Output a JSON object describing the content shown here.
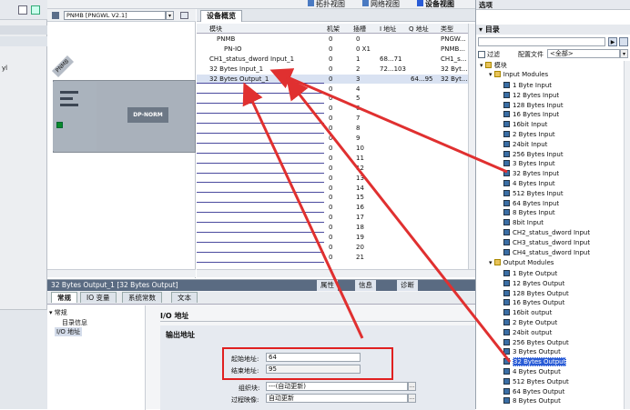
{
  "top_toolbar": {
    "topology_view": "拓扑视图",
    "network_view": "网络视图",
    "device_view": "设备视图"
  },
  "device_toolbar": {
    "device_select": "PNMB [PNGWL V2.1]"
  },
  "device_graphic": {
    "rack_label": "PNMB",
    "module_label": "DP-NORM"
  },
  "overview": {
    "title": "设备概览",
    "headers": [
      "模块",
      "机架",
      "插槽",
      "I 地址",
      "Q 地址",
      "类型"
    ],
    "rows": [
      {
        "module": "PNMB",
        "rack": "0",
        "slot": "0",
        "i": "",
        "q": "",
        "type": "PNGW..."
      },
      {
        "module": "PN-IO",
        "rack": "0",
        "slot": "0 X1",
        "i": "",
        "q": "",
        "type": "PNMB..."
      },
      {
        "module": "CH1_status_dword Input_1",
        "rack": "0",
        "slot": "1",
        "i": "68...71",
        "q": "",
        "type": "CH1_s..."
      },
      {
        "module": "32 Bytes Input_1",
        "rack": "0",
        "slot": "2",
        "i": "72...103",
        "q": "",
        "type": "32 Byt..."
      },
      {
        "module": "32 Bytes Output_1",
        "rack": "0",
        "slot": "3",
        "i": "",
        "q": "64...95",
        "type": "32 Byt..."
      },
      {
        "module": "",
        "rack": "0",
        "slot": "4",
        "i": "",
        "q": "",
        "type": ""
      },
      {
        "module": "",
        "rack": "0",
        "slot": "5",
        "i": "",
        "q": "",
        "type": ""
      },
      {
        "module": "",
        "rack": "0",
        "slot": "6",
        "i": "",
        "q": "",
        "type": ""
      },
      {
        "module": "",
        "rack": "0",
        "slot": "7",
        "i": "",
        "q": "",
        "type": ""
      },
      {
        "module": "",
        "rack": "0",
        "slot": "8",
        "i": "",
        "q": "",
        "type": ""
      },
      {
        "module": "",
        "rack": "0",
        "slot": "9",
        "i": "",
        "q": "",
        "type": ""
      },
      {
        "module": "",
        "rack": "0",
        "slot": "10",
        "i": "",
        "q": "",
        "type": ""
      },
      {
        "module": "",
        "rack": "0",
        "slot": "11",
        "i": "",
        "q": "",
        "type": ""
      },
      {
        "module": "",
        "rack": "0",
        "slot": "12",
        "i": "",
        "q": "",
        "type": ""
      },
      {
        "module": "",
        "rack": "0",
        "slot": "13",
        "i": "",
        "q": "",
        "type": ""
      },
      {
        "module": "",
        "rack": "0",
        "slot": "14",
        "i": "",
        "q": "",
        "type": ""
      },
      {
        "module": "",
        "rack": "0",
        "slot": "15",
        "i": "",
        "q": "",
        "type": ""
      },
      {
        "module": "",
        "rack": "0",
        "slot": "16",
        "i": "",
        "q": "",
        "type": ""
      },
      {
        "module": "",
        "rack": "0",
        "slot": "17",
        "i": "",
        "q": "",
        "type": ""
      },
      {
        "module": "",
        "rack": "0",
        "slot": "18",
        "i": "",
        "q": "",
        "type": ""
      },
      {
        "module": "",
        "rack": "0",
        "slot": "19",
        "i": "",
        "q": "",
        "type": ""
      },
      {
        "module": "",
        "rack": "0",
        "slot": "20",
        "i": "",
        "q": "",
        "type": ""
      },
      {
        "module": "",
        "rack": "0",
        "slot": "21",
        "i": "",
        "q": "",
        "type": ""
      }
    ]
  },
  "props": {
    "title": "32 Bytes Output_1 [32 Bytes Output]",
    "panel_tabs": [
      "属性",
      "信息",
      "诊断"
    ],
    "tabs": [
      "常规",
      "IO 变量",
      "系统常数",
      "文本"
    ],
    "nav": [
      "常规",
      "目录信息",
      "I/O 地址"
    ],
    "section": "I/O 地址",
    "subsection": "输出地址",
    "start_label": "起始地址:",
    "start_value": "64",
    "end_label": "结束地址:",
    "end_value": "95",
    "org_label": "组织块:",
    "org_value": "---(自动更新)",
    "proc_label": "过程映像:",
    "proc_value": "自动更新"
  },
  "catalog": {
    "header": "选项",
    "title": "目录",
    "filter_label": "过滤",
    "profile_label": "配置文件",
    "profile_value": "<全部>",
    "root": "模块",
    "input_group": "Input Modules",
    "inputs": [
      "1 Byte Input",
      "12 Bytes Input",
      "128 Bytes Input",
      "16 Bytes Input",
      "16bit Input",
      "2 Bytes Input",
      "24bit Input",
      "256 Bytes Input",
      "3 Bytes Input",
      "32 Bytes Input",
      "4 Bytes Input",
      "512 Bytes Input",
      "64 Bytes Input",
      "8 Bytes Input",
      "8bit Input",
      "CH2_status_dword Input",
      "CH3_status_dword Input",
      "CH4_status_dword Input"
    ],
    "output_group": "Output Modules",
    "outputs": [
      "1 Byte Output",
      "12 Bytes Output",
      "128 Bytes Output",
      "16 Bytes Output",
      "16bit output",
      "2 Byte Output",
      "24bit output",
      "256 Bytes Output",
      "3 Bytes Output",
      "32 Bytes Output",
      "4 Bytes Output",
      "512 Bytes Output",
      "64 Bytes Output",
      "8 Bytes Output"
    ],
    "selected": "32 Bytes Output"
  },
  "left_panel": {
    "partial_label": "yl"
  },
  "colors": {
    "accent": "#2a5cd6",
    "highlight_box": "#e02020",
    "arrow": "#e03030",
    "row_line": "#4a4a9e"
  }
}
